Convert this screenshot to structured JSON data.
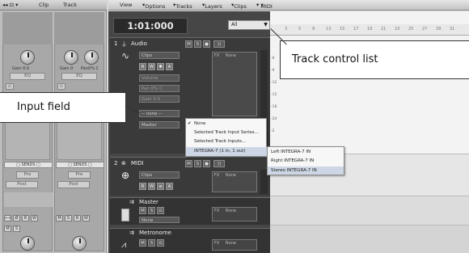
{
  "inspector": {
    "top_left_icon": "◂◂ ⊡ ▾",
    "tabs": [
      "Clip",
      "Track"
    ],
    "strip1": {
      "knob1_label": "Gain 0.0",
      "eq_label": "EQ",
      "sends_label": "SENDS",
      "btn_labels": [
        "Pre",
        "Post"
      ]
    },
    "strip2": {
      "knob1_label": "Gain 0",
      "knob2_label": "Pan0% C",
      "eq_label": "EQ",
      "sends_label": "SENDS",
      "btn_labels": [
        "Pre",
        "Post"
      ]
    },
    "bottom_buttons": [
      "R",
      "W",
      "M",
      "S",
      "R",
      "W"
    ]
  },
  "menubar": {
    "items": [
      "View",
      "Options",
      "Tracks",
      "Layers",
      "Clips",
      "MIDI"
    ]
  },
  "time_display": "1:01:000",
  "track_filter": "All",
  "ruler_marks": [
    "3",
    "5",
    "9",
    "13",
    "15",
    "17",
    "19",
    "21",
    "23",
    "25",
    "27",
    "29",
    "31"
  ],
  "tracks": [
    {
      "number": "1",
      "name": "Audio",
      "clips_label": "Clips",
      "buttons": [
        "M",
        "S",
        "R"
      ],
      "rw_buttons": [
        "R",
        "W",
        "✱",
        "A"
      ],
      "fields": [
        "Volume",
        "Pan  0% C",
        "Gain  0.0",
        "-- none --",
        "Master"
      ],
      "fx_label": "FX",
      "fx_value": "None"
    },
    {
      "number": "2",
      "name": "MIDI",
      "clips_label": "Clips",
      "buttons": [
        "M",
        "S",
        "R"
      ],
      "rw_buttons": [
        "R",
        "W",
        "≡",
        "A"
      ],
      "fx_label": "FX",
      "fx_value": "None"
    },
    {
      "number": "",
      "name": "Master",
      "buttons": [
        "M",
        "S",
        "⊡"
      ],
      "fields": [
        "None"
      ],
      "fx_label": "FX",
      "fx_value": "None"
    },
    {
      "number": "",
      "name": "Metronome",
      "buttons": [
        "M",
        "S",
        "⊡"
      ],
      "fx_label": "FX",
      "fx_value": "None"
    }
  ],
  "input_menu": {
    "items": [
      "None",
      "Selected Track Input Series…",
      "Selected Track Inputs…",
      "INTEGRA-7 (1 in, 1 out)"
    ],
    "checked_index": 0,
    "highlighted_index": 3
  },
  "submenu": {
    "items": [
      "Left  INTEGRA-7 IN",
      "Right  INTEGRA-7 IN",
      "Stereo  INTEGRA-7 IN"
    ],
    "highlighted_index": 2
  },
  "callouts": {
    "track_control_list": "Track control list",
    "input_field": "Input field"
  },
  "meter_scale": [
    "-6",
    "-9",
    "-12",
    "-15",
    "-18",
    "-24",
    "-2"
  ]
}
